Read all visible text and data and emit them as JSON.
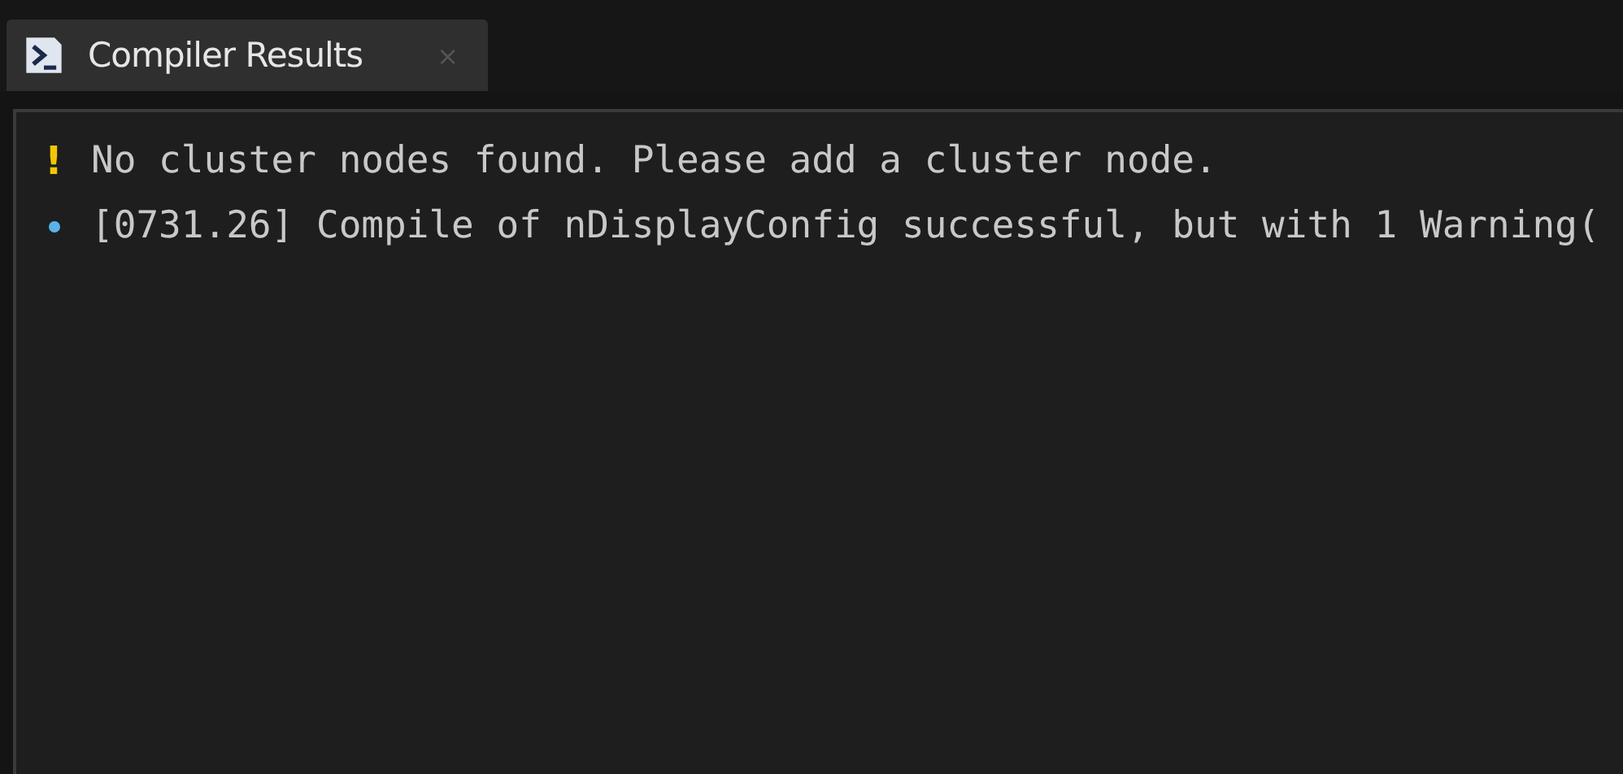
{
  "tabs": [
    {
      "label": "Compiler Results",
      "selected": true,
      "close": "×"
    }
  ],
  "messages": [
    {
      "kind": "warning",
      "icon": "!",
      "text": "No cluster nodes found. Please add a cluster node."
    },
    {
      "kind": "info",
      "text": "[0731.26] Compile of nDisplayConfig successful, but with 1 Warning("
    }
  ]
}
